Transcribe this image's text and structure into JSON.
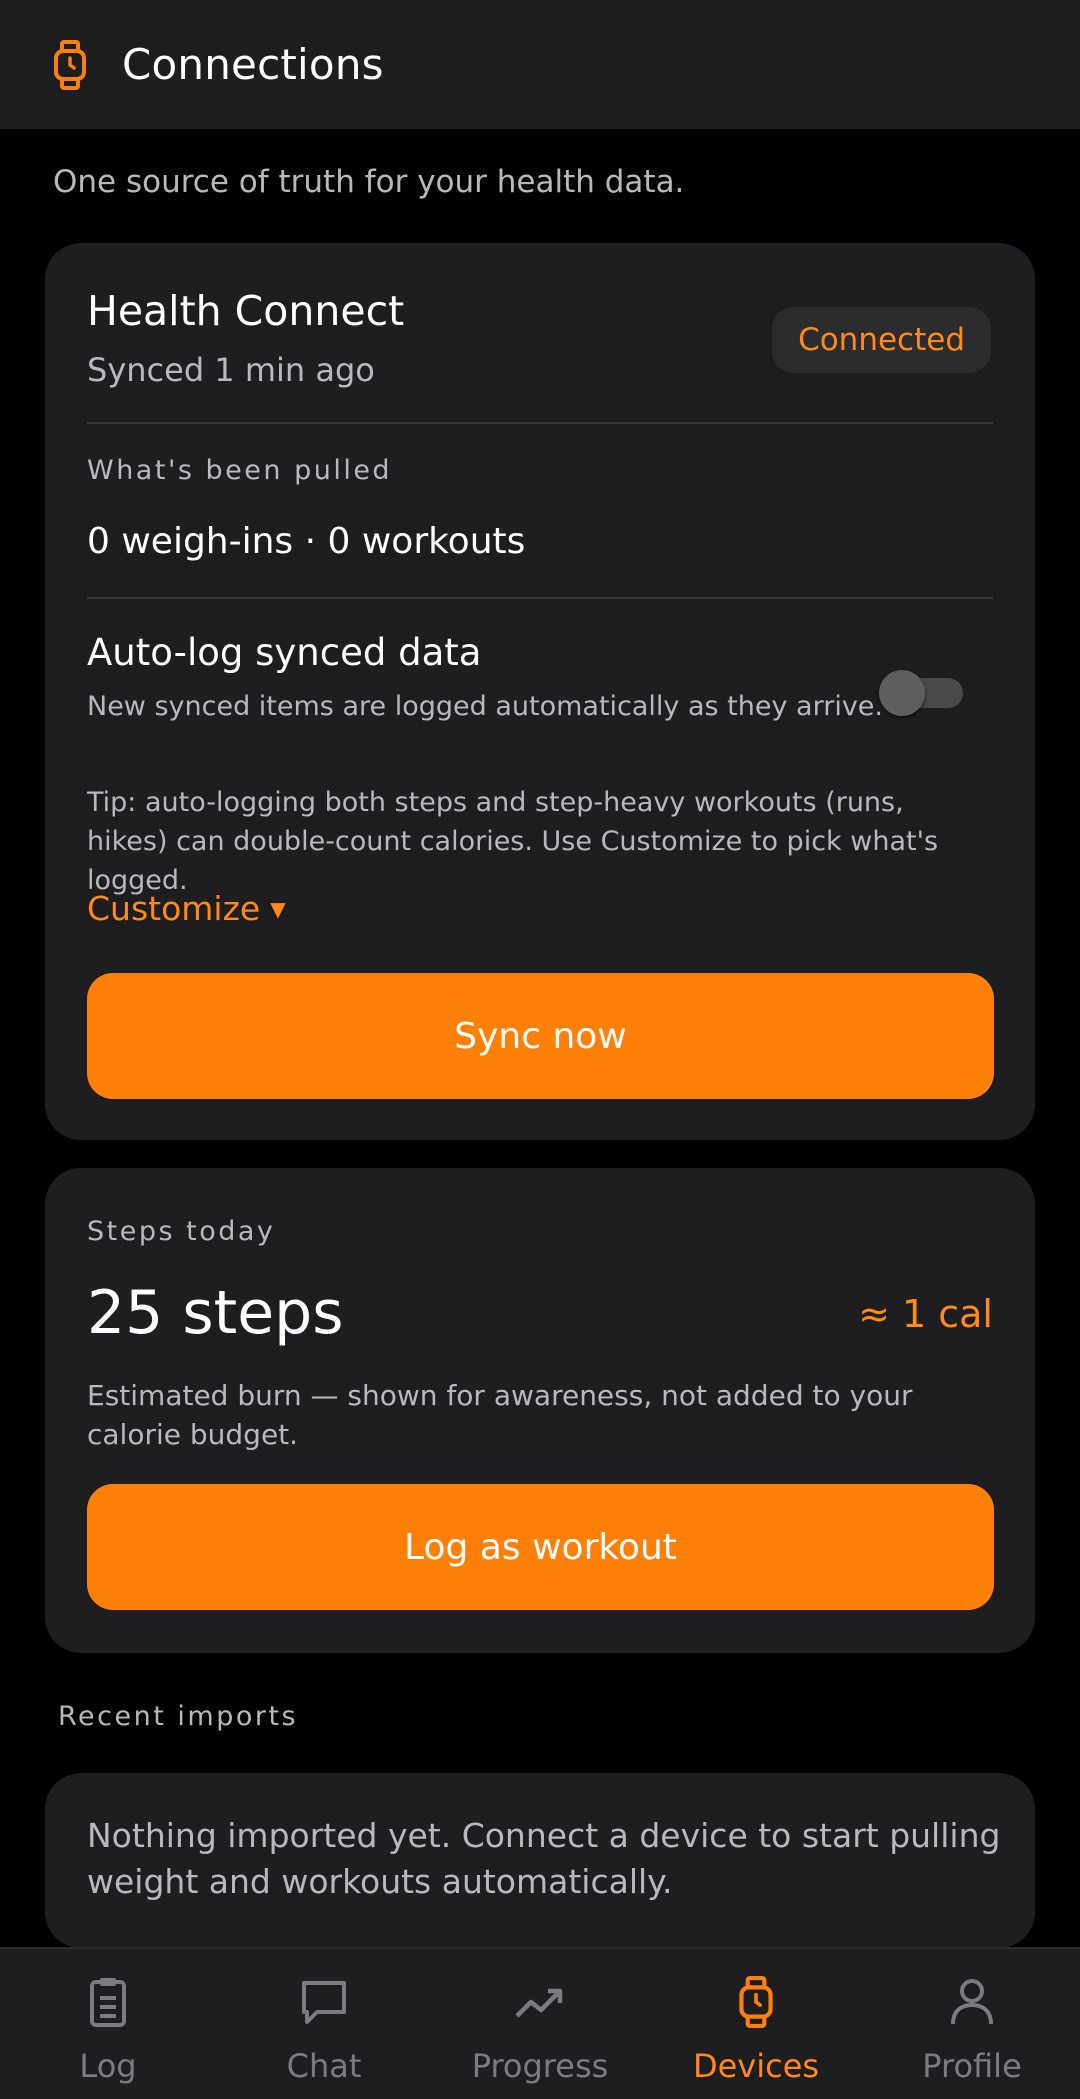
{
  "header": {
    "title": "Connections",
    "icon": "watch-icon"
  },
  "tagline": "One source of truth for your health data.",
  "health_connect": {
    "title": "Health Connect",
    "synced": "Synced 1 min ago",
    "status": "Connected",
    "pulled_label": "What's been pulled",
    "pulled_value": "0 weigh-ins · 0 workouts",
    "autolog_title": "Auto-log synced data",
    "autolog_desc": "New synced items are logged automatically as they arrive.",
    "autolog_enabled": false,
    "tip": "Tip: auto-logging both steps and step-heavy workouts (runs, hikes) can double-count calories. Use Customize to pick what's logged.",
    "customize_label": "Customize",
    "sync_button": "Sync now"
  },
  "steps": {
    "label": "Steps today",
    "value": "25 steps",
    "calories": "≈ 1 cal",
    "note": "Estimated burn — shown for awareness, not added to your calorie budget.",
    "log_button": "Log as workout"
  },
  "recent": {
    "label": "Recent imports",
    "empty": "Nothing imported yet. Connect a device to start pulling weight and workouts automatically."
  },
  "nav": {
    "items": [
      {
        "label": "Log",
        "icon": "clipboard-icon"
      },
      {
        "label": "Chat",
        "icon": "chat-icon"
      },
      {
        "label": "Progress",
        "icon": "trending-up-icon"
      },
      {
        "label": "Devices",
        "icon": "watch-icon",
        "active": true
      },
      {
        "label": "Profile",
        "icon": "person-icon"
      }
    ]
  },
  "colors": {
    "accent": "#ff8008",
    "background": "#000000",
    "surface": "#1e1e20",
    "muted": "#b8b8bd"
  }
}
